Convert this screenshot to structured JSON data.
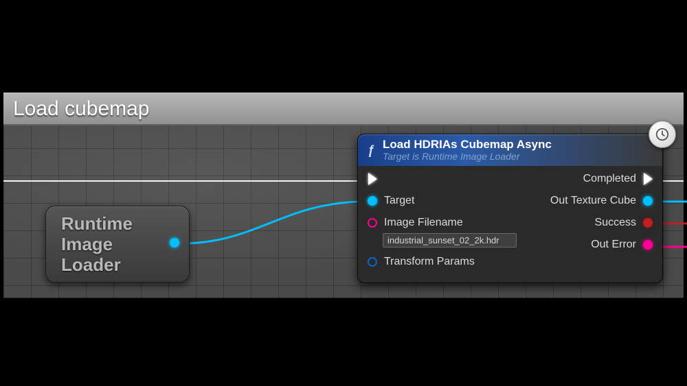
{
  "comment": {
    "title": "Load cubemap"
  },
  "variable_node": {
    "label": "Runtime\nImage\nLoader"
  },
  "function_node": {
    "title": "Load HDRIAs Cubemap Async",
    "subtitle": "Target is Runtime Image Loader",
    "latent_icon": "clock",
    "inputs": {
      "exec": "",
      "target": "Target",
      "image_filename_label": "Image Filename",
      "image_filename_value": "industrial_sunset_02_2k.hdr",
      "transform_params": "Transform Params"
    },
    "outputs": {
      "completed": "Completed",
      "out_texture_cube": "Out Texture Cube",
      "success": "Success",
      "out_error": "Out Error"
    }
  },
  "colors": {
    "object_pin": "#00bfff",
    "string_pin": "#ff0095",
    "struct_pin": "#0a66c4",
    "bool_pin": "#c02020"
  }
}
